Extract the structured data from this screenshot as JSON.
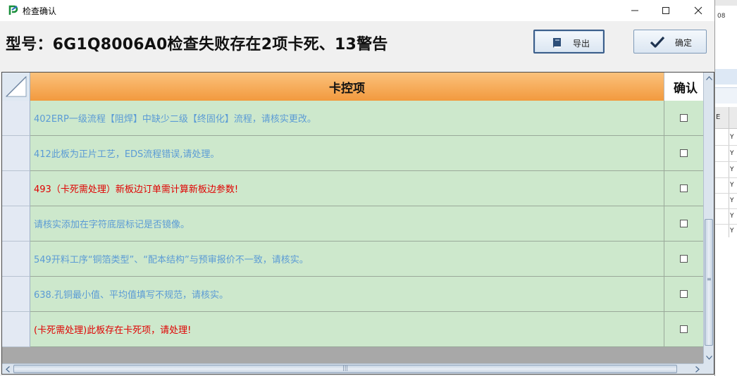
{
  "window": {
    "title": "检查确认"
  },
  "header": {
    "title": "型号：6G1Q8006A0检查失败存在2项卡死、13警告"
  },
  "toolbar": {
    "export_label": "导出",
    "ok_label": "确定"
  },
  "grid": {
    "columns": [
      "卡控项",
      "确认"
    ],
    "rows": [
      {
        "text": "402ERP一级流程【阻焊】中缺少二级【终固化】流程，请核实更改。",
        "level": "warning",
        "checked": false
      },
      {
        "text": "412此板为正片工艺，EDS流程错误,请处理。",
        "level": "warning",
        "checked": false
      },
      {
        "text": "493（卡死需处理）新板边订单需计算新板边参数!",
        "level": "error",
        "checked": false
      },
      {
        "text": "请核实添加在字符底层标记是否镜像。",
        "level": "warning",
        "checked": false
      },
      {
        "text": "549开料工序“铜箔类型”、“配本结构”与预审报价不一致，请核实。",
        "level": "warning",
        "checked": false
      },
      {
        "text": "638.孔铜最小值、平均值填写不规范，请核实。",
        "level": "warning",
        "checked": false
      },
      {
        "text": "(卡死需处理)此板存在卡死项，请处理!",
        "level": "error",
        "checked": false
      }
    ]
  },
  "background_app": {
    "fragment_text": "08",
    "header_fragment": "E",
    "cells": [
      "Y",
      "Y",
      "Y",
      "Y",
      "Y",
      "Y",
      "Y"
    ]
  },
  "colors": {
    "warning_text": "#5b9bd5",
    "error_text": "#e00000",
    "row_bg": "#cde8cc",
    "header_orange": "#f29a3e"
  },
  "icons": {
    "app": "app-logo-icon",
    "export": "book-icon",
    "ok": "checkmark-icon"
  }
}
